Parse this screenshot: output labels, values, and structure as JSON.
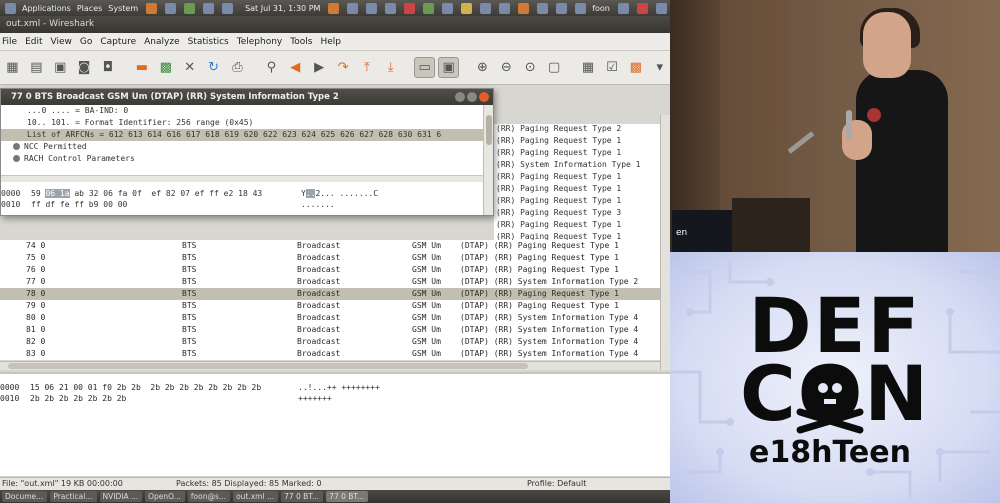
{
  "top_panel": {
    "applications": "Applications",
    "places": "Places",
    "system": "System",
    "clock": "Sat Jul 31,  1:30 PM",
    "user": "foon"
  },
  "window": {
    "title": "out.xml - Wireshark"
  },
  "menu": [
    "File",
    "Edit",
    "View",
    "Go",
    "Capture",
    "Analyze",
    "Statistics",
    "Telephony",
    "Tools",
    "Help"
  ],
  "packet_window": {
    "title": "77 0 BTS Broadcast GSM Um (DTAP) (RR) System Information Type 2",
    "tree": [
      "...0 .... = BA-IND: 0",
      "10.. 101. = Format Identifier: 256 range (0x45)",
      "List of ARFCNs = 612 613 614 616 617 618 619 620 622 623 624 625 626 627 628 630 631 6",
      "NCC Permitted",
      "RACH Control Parameters"
    ],
    "hex": [
      {
        "offset": "0000",
        "bytes_before": "59 ",
        "bytes_hl": "06 1a",
        "bytes_after": " ab 32 06 fa 0f  ef 82 07 ef ff e2 18 43",
        "ascii_before": "Y",
        "ascii_hl": "..",
        "ascii_after": "2... .......C"
      },
      {
        "offset": "0010",
        "bytes_before": "ff df fe ff b9 00 00",
        "bytes_hl": "",
        "bytes_after": "",
        "ascii_before": ".......",
        "ascii_hl": "",
        "ascii_after": ""
      }
    ]
  },
  "info_column_top": [
    "(RR) Paging Request Type 2",
    "(RR) Paging Request Type 1",
    "(RR) Paging Request Type 1",
    "(RR) System Information Type 1",
    "(RR) Paging Request Type 1",
    "(RR) Paging Request Type 1",
    "(RR) Paging Request Type 1",
    "(RR) Paging Request Type 3",
    "(RR) Paging Request Type 1",
    "(RR) Paging Request Type 1"
  ],
  "packets": [
    {
      "no": "74 0",
      "src": "BTS",
      "dst": "Broadcast",
      "proto": "GSM Um",
      "info": "(DTAP) (RR) Paging Request Type 1"
    },
    {
      "no": "75 0",
      "src": "BTS",
      "dst": "Broadcast",
      "proto": "GSM Um",
      "info": "(DTAP) (RR) Paging Request Type 1"
    },
    {
      "no": "76 0",
      "src": "BTS",
      "dst": "Broadcast",
      "proto": "GSM Um",
      "info": "(DTAP) (RR) Paging Request Type 1"
    },
    {
      "no": "77 0",
      "src": "BTS",
      "dst": "Broadcast",
      "proto": "GSM Um",
      "info": "(DTAP) (RR) System Information Type 2"
    },
    {
      "no": "78 0",
      "src": "BTS",
      "dst": "Broadcast",
      "proto": "GSM Um",
      "info": "(DTAP) (RR) Paging Request Type 1"
    },
    {
      "no": "79 0",
      "src": "BTS",
      "dst": "Broadcast",
      "proto": "GSM Um",
      "info": "(DTAP) (RR) Paging Request Type 1"
    },
    {
      "no": "80 0",
      "src": "BTS",
      "dst": "Broadcast",
      "proto": "GSM Um",
      "info": "(DTAP) (RR) System Information Type 4"
    },
    {
      "no": "81 0",
      "src": "BTS",
      "dst": "Broadcast",
      "proto": "GSM Um",
      "info": "(DTAP) (RR) System Information Type 4"
    },
    {
      "no": "82 0",
      "src": "BTS",
      "dst": "Broadcast",
      "proto": "GSM Um",
      "info": "(DTAP) (RR) System Information Type 4"
    },
    {
      "no": "83 0",
      "src": "BTS",
      "dst": "Broadcast",
      "proto": "GSM Um",
      "info": "(DTAP) (RR) System Information Type 4"
    }
  ],
  "selected_packet_index": 4,
  "bottom_hex": [
    {
      "offset": "0000",
      "bytes": "15 06 21 00 01 f0 2b 2b  2b 2b 2b 2b 2b 2b 2b 2b",
      "ascii": "..!...++ ++++++++"
    },
    {
      "offset": "0010",
      "bytes": "2b 2b 2b 2b 2b 2b 2b",
      "ascii": "+++++++"
    }
  ],
  "status": {
    "file": "File: \"out.xml\" 19 KB 00:00:00",
    "packets": "Packets: 85 Displayed: 85 Marked: 0",
    "profile": "Profile: Default"
  },
  "taskbar": [
    "Docume...",
    "Practical...",
    "NVIDIA ...",
    "OpenO...",
    "foon@s...",
    "out.xml ...",
    "77 0 BT...",
    "77 0 BT..."
  ],
  "video": {
    "screen_text": "en"
  },
  "logo": {
    "line1": "DEF",
    "line2": "CON",
    "line3": "e18hTeen"
  },
  "colors": {
    "selection": "#c3bfb0",
    "toolbar_accent": "#e06a1e",
    "logo_ink": "#0c0c0c"
  }
}
